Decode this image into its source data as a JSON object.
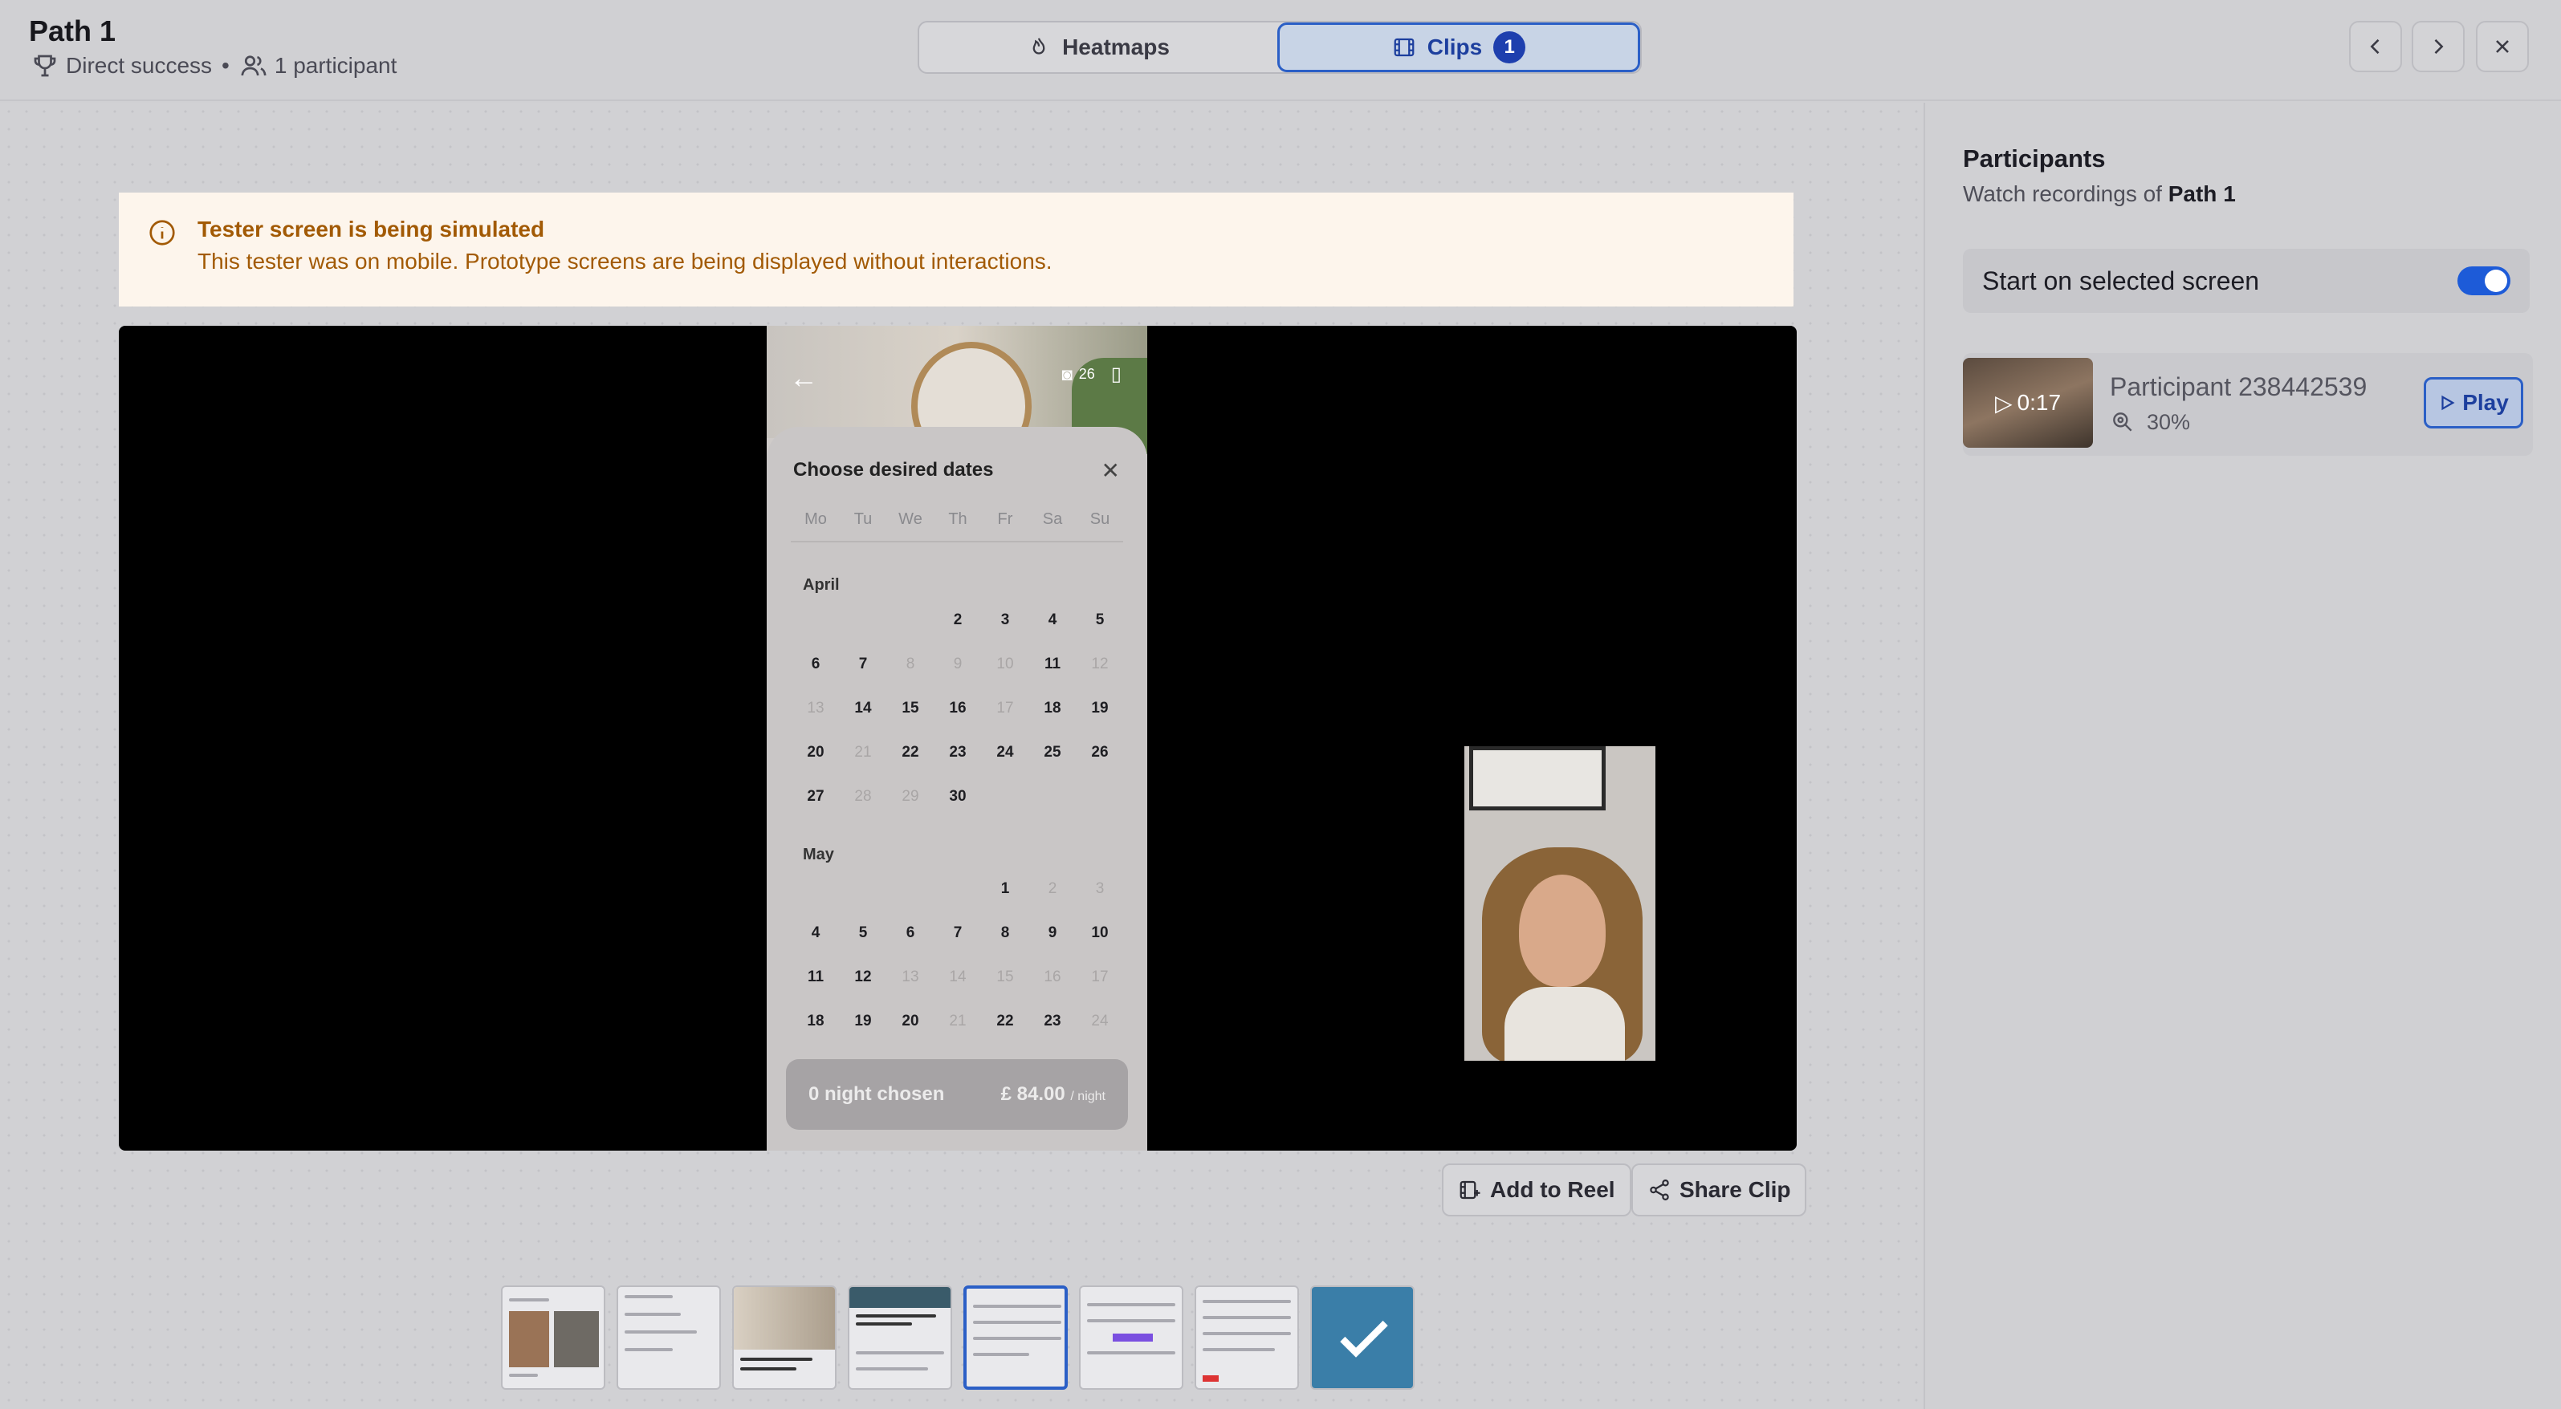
{
  "header": {
    "title": "Path 1",
    "result": "Direct success",
    "separator": "•",
    "participants": "1 participant",
    "tabs": [
      {
        "label": "Heatmaps",
        "icon": "flame-icon"
      },
      {
        "label": "Clips",
        "icon": "film-icon",
        "count": "1"
      }
    ]
  },
  "banner": {
    "title": "Tester screen is being simulated",
    "text": "This tester was on mobile. Prototype screens are being displayed without interactions."
  },
  "phone": {
    "photo_count": "26",
    "sheet_title": "Choose desired dates",
    "weekdays": [
      "Mo",
      "Tu",
      "We",
      "Th",
      "Fr",
      "Sa",
      "Su"
    ],
    "april": "April",
    "may": "May",
    "cta_left": "0 night chosen",
    "cta_price": "£ 84.00",
    "cta_unit": "/ night"
  },
  "actions": {
    "add_to_reel": "Add to Reel",
    "share_clip": "Share Clip"
  },
  "sidebar": {
    "title": "Participants",
    "sub_prefix": "Watch recordings of",
    "sub_path": "Path 1",
    "toggle_label": "Start on selected screen",
    "toggle_on": true,
    "participant": {
      "duration": "0:17",
      "name": "Participant 238442539",
      "percent": "30%",
      "play": "Play"
    }
  },
  "colors": {
    "accent": "#2b5fc6",
    "warning_text": "#a25a05",
    "banner_bg": "#fdf5ec"
  }
}
